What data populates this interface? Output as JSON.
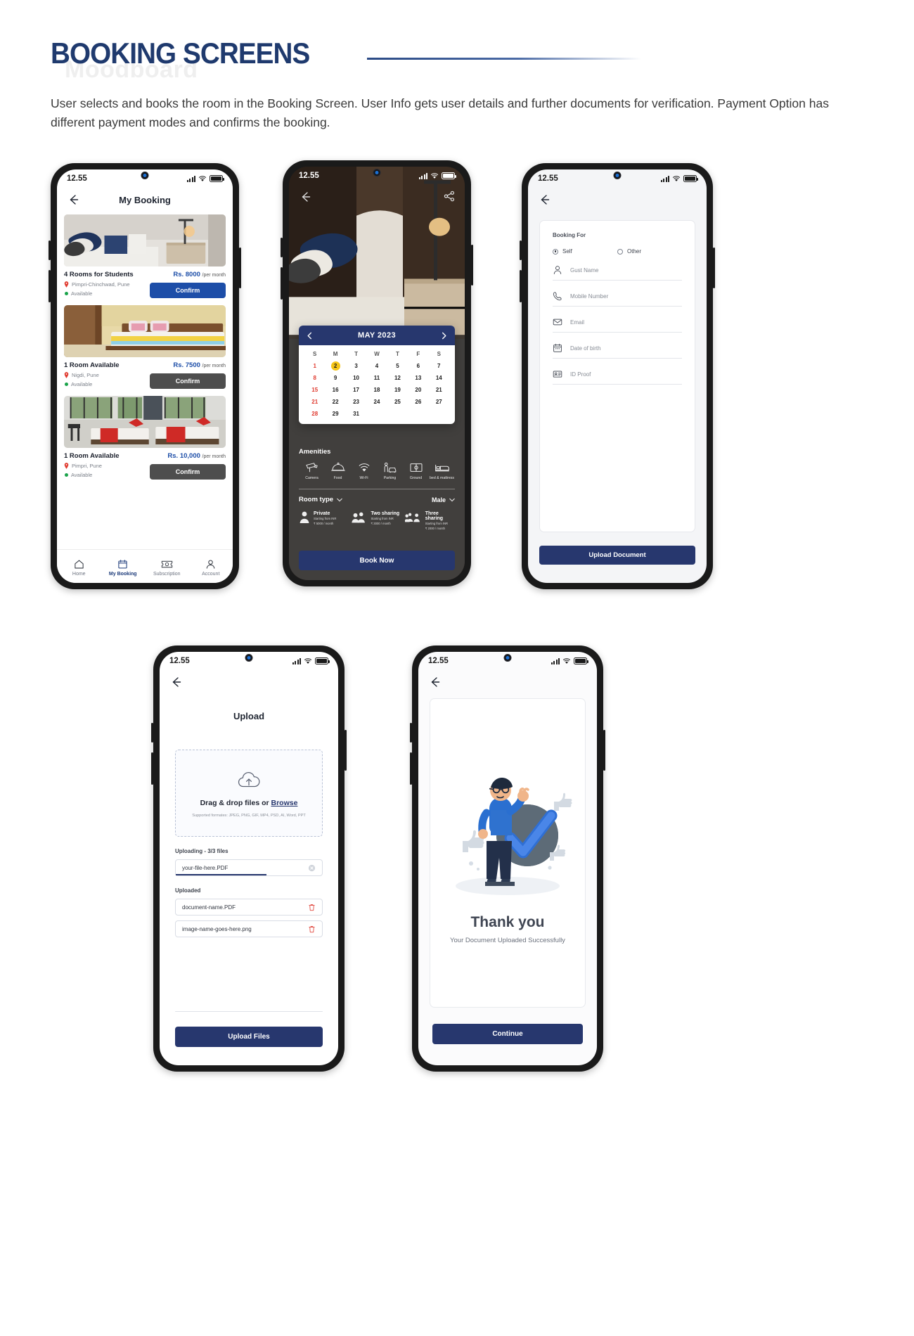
{
  "header": {
    "title": "BOOKING SCREENS",
    "ghost": "Moodboard",
    "description": "User selects and books the room in the Booking Screen. User Info gets user details and further documents for verification. Payment Option has different payment modes and confirms the booking."
  },
  "colors": {
    "brand_navy": "#27376e",
    "title_navy": "#1f3a6e",
    "price_blue": "#1d4ea8",
    "available_green": "#1aa34a",
    "pin_red": "#e03a2f",
    "selected_yellow": "#f5c518",
    "disabled_gray": "#4e4e4e"
  },
  "status_bar": {
    "time": "12.55",
    "signal": "signal-bars-icon",
    "wifi": "wifi-icon",
    "battery": "battery-icon"
  },
  "phone1": {
    "nav_title": "My Booking",
    "back_icon": "back-arrow-icon",
    "cards": [
      {
        "title": "4 Rooms for Students",
        "location": "Pimpri-Chinchwad, Pune",
        "status": "Available",
        "price": "Rs. 8000",
        "price_unit": "/per month",
        "button": "Confirm",
        "button_style": "primary"
      },
      {
        "title": "1 Room Available",
        "location": "Nigdi, Pune",
        "status": "Available",
        "price": "Rs. 7500",
        "price_unit": "/per month",
        "button": "Confirm",
        "button_style": "disabled"
      },
      {
        "title": "1 Room Available",
        "location": "Pimpri, Pune",
        "status": "Available",
        "price": "Rs. 10,000",
        "price_unit": "/per month",
        "button": "Confirm",
        "button_style": "disabled"
      }
    ],
    "bottom_nav": [
      {
        "label": "Home",
        "icon": "home-icon",
        "active": false
      },
      {
        "label": "My Booking",
        "icon": "calendar-icon",
        "active": true
      },
      {
        "label": "Subscription",
        "icon": "ticket-icon",
        "active": false
      },
      {
        "label": "Account",
        "icon": "person-icon",
        "active": false
      }
    ]
  },
  "phone2": {
    "back_icon": "back-arrow-icon",
    "share_icon": "share-icon",
    "calendar": {
      "month_label": "MAY 2023",
      "prev_icon": "chevron-left-icon",
      "next_icon": "chevron-right-icon",
      "weekdays": [
        "S",
        "M",
        "T",
        "W",
        "T",
        "F",
        "S"
      ],
      "weeks": [
        [
          "1",
          "2",
          "3",
          "4",
          "5",
          "6",
          "7"
        ],
        [
          "8",
          "9",
          "10",
          "11",
          "12",
          "13",
          "14"
        ],
        [
          "15",
          "16",
          "17",
          "18",
          "19",
          "20",
          "21"
        ],
        [
          "21",
          "22",
          "23",
          "24",
          "25",
          "26",
          "27"
        ],
        [
          "28",
          "29",
          "31",
          "",
          "",
          "",
          ""
        ]
      ],
      "selected_day": "2"
    },
    "amenities_heading": "Amenities",
    "amenities": [
      {
        "label": "Camera",
        "icon": "cctv-camera-icon"
      },
      {
        "label": "Food",
        "icon": "food-tray-icon"
      },
      {
        "label": "Wi-Fi",
        "icon": "wifi-icon"
      },
      {
        "label": "Parking",
        "icon": "parking-car-icon"
      },
      {
        "label": "Ground",
        "icon": "ground-icon"
      },
      {
        "label": "bed & mattress",
        "icon": "bed-icon"
      }
    ],
    "room_type_heading": "Room type",
    "room_type_dropdown_icon": "chevron-down-icon",
    "gender_value": "Male",
    "gender_dropdown_icon": "chevron-down-icon",
    "room_types": [
      {
        "name": "Private",
        "line1": "Starting from INR",
        "line2": "₹ 5000 / month",
        "icon": "one-person-icon"
      },
      {
        "name": "Two sharing",
        "line1": "Starting from INR",
        "line2": "₹ 3000 / month",
        "icon": "two-person-icon"
      },
      {
        "name": "Three sharing",
        "line1": "Starting from INR",
        "line2": "₹ 2000 / month",
        "icon": "three-person-icon"
      }
    ],
    "book_now": "Book Now"
  },
  "phone3": {
    "back_icon": "back-arrow-icon",
    "booking_for_label": "Booking For",
    "options": [
      {
        "label": "Self",
        "selected": true
      },
      {
        "label": "Other",
        "selected": false
      }
    ],
    "fields": [
      {
        "placeholder": "Gust Name",
        "icon": "person-icon"
      },
      {
        "placeholder": "Mobile Number",
        "icon": "phone-icon"
      },
      {
        "placeholder": "Email",
        "icon": "envelope-icon"
      },
      {
        "placeholder": "Date of birth",
        "icon": "calendar-icon"
      },
      {
        "placeholder": "ID Proof",
        "icon": "id-card-icon"
      }
    ],
    "submit": "Upload Document"
  },
  "phone4": {
    "back_icon": "back-arrow-icon",
    "nav_title": "Upload",
    "dropzone": {
      "icon": "cloud-upload-icon",
      "text": "Drag & drop files or ",
      "link": "Browse",
      "supported": "Supported formates: JPEG, PNG, GIF, MP4, PSD, AI, Word, PPT"
    },
    "uploading_label": "Uploading - 3/3 files",
    "uploading_file": {
      "name": "your-file-here.PDF",
      "progress": 62,
      "icon": "close-circle-icon"
    },
    "uploaded_label": "Uploaded",
    "uploaded_files": [
      {
        "name": "document-name.PDF",
        "icon": "trash-icon"
      },
      {
        "name": "image-name-goes-here.png",
        "icon": "trash-icon"
      }
    ],
    "submit": "Upload Files"
  },
  "phone5": {
    "back_icon": "back-arrow-icon",
    "illustration": "person-with-checkmark-illustration",
    "title": "Thank you",
    "subtitle": "Your Document Uploaded Successfully",
    "submit": "Continue"
  }
}
